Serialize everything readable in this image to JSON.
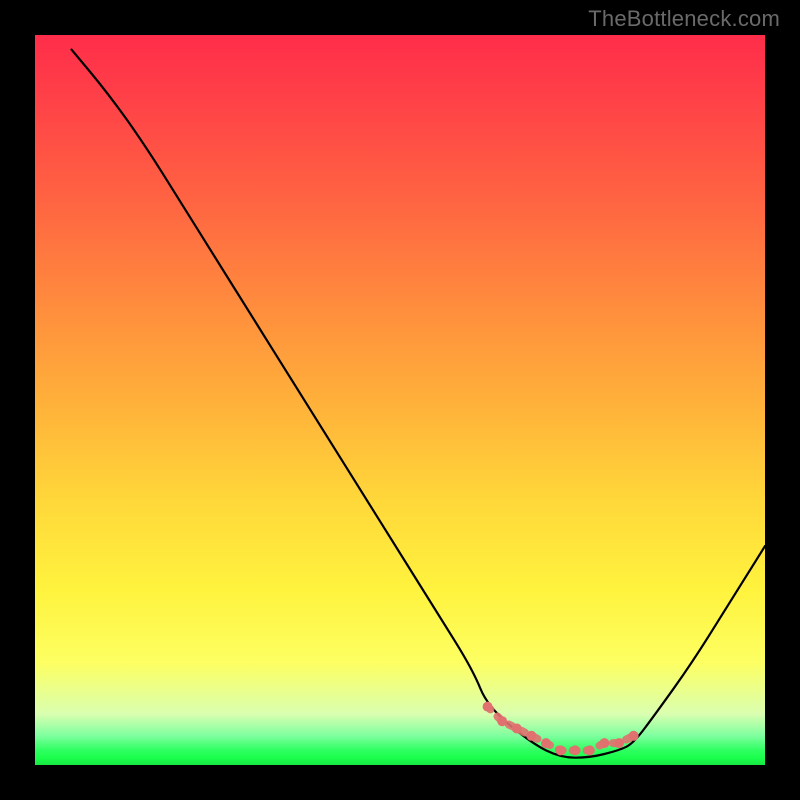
{
  "watermark": "TheBottleneck.com",
  "chart_data": {
    "type": "line",
    "title": "",
    "xlabel": "",
    "ylabel": "",
    "xlim": [
      0,
      100
    ],
    "ylim": [
      0,
      100
    ],
    "grid": false,
    "legend": false,
    "series": [
      {
        "name": "bottleneck-curve",
        "x": [
          5,
          10,
          15,
          20,
          25,
          30,
          35,
          40,
          45,
          50,
          55,
          60,
          62,
          68,
          72,
          76,
          80,
          82,
          85,
          90,
          95,
          100
        ],
        "values": [
          98,
          92,
          85,
          77,
          69,
          61,
          53,
          45,
          37,
          29,
          21,
          13,
          8,
          3,
          1,
          1,
          2,
          3,
          7,
          14,
          22,
          30
        ]
      }
    ],
    "markers": {
      "name": "bottom-dots",
      "color": "#e0716f",
      "x": [
        62,
        64,
        66,
        68,
        70,
        72,
        74,
        76,
        78,
        80,
        82
      ],
      "values": [
        8,
        6,
        5,
        4,
        3,
        2,
        2,
        2,
        3,
        3,
        4
      ]
    },
    "background_gradient": {
      "top": "#ff2d4a",
      "mid": "#ffd83a",
      "bottom": "#1aff4c"
    }
  }
}
